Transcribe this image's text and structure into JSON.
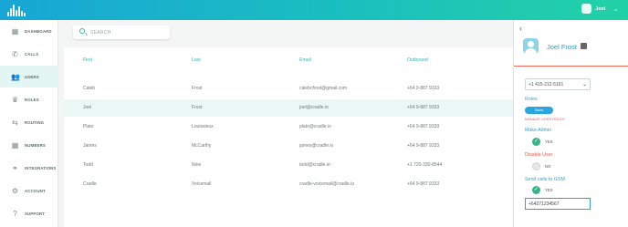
{
  "topbar": {
    "user_name": "Joel"
  },
  "sidebar": {
    "items": [
      {
        "label": "DASHBOARD",
        "icon": "dashboard-icon",
        "glyph": "▦"
      },
      {
        "label": "CALLS",
        "icon": "phone-icon",
        "glyph": "✆"
      },
      {
        "label": "USERS",
        "icon": "users-icon",
        "glyph": "👥",
        "active": true
      },
      {
        "label": "ROLES",
        "icon": "roles-icon",
        "glyph": "♛"
      },
      {
        "label": "ROUTING",
        "icon": "routing-icon",
        "glyph": "⇆"
      },
      {
        "label": "NUMBERS",
        "icon": "numbers-icon",
        "glyph": "▦"
      },
      {
        "label": "INTEGRATIONS",
        "icon": "integrations-icon",
        "glyph": "⚭"
      },
      {
        "label": "ACCOUNT",
        "icon": "account-icon",
        "glyph": "⚙"
      },
      {
        "label": "SUPPORT",
        "icon": "support-icon",
        "glyph": "?"
      }
    ]
  },
  "search": {
    "placeholder": "SEARCH"
  },
  "table": {
    "headers": {
      "first": "First",
      "last": "Last",
      "email": "Email",
      "outbound": "Outbound"
    },
    "rows": [
      {
        "first": "Caleb",
        "last": "Frost",
        "email": "calebcfrost@gmail.com",
        "outbound": "+64 9-887 9333"
      },
      {
        "first": "Joel",
        "last": "Frost",
        "email": "joel@cradle.io",
        "outbound": "+64 9-887 9333",
        "selected": true
      },
      {
        "first": "Plato",
        "last": "Louissieux",
        "email": "plato@cradle.io",
        "outbound": "+64 9-887 9333"
      },
      {
        "first": "James",
        "last": "McCarthy",
        "email": "james@cradle.io",
        "outbound": "+64 9-887 9333"
      },
      {
        "first": "Todd",
        "last": "Nine",
        "email": "todd@cradle.io",
        "outbound": "+1 720-330-8544"
      },
      {
        "first": "Cradle",
        "last": "Voicemail",
        "email": "cradle-voicemail@cradle.io",
        "outbound": "+64 9-887 9333"
      }
    ]
  },
  "panel": {
    "name": "Joel Frost",
    "phone_value": "+1 415-212-5161",
    "roles_label": "Roles",
    "role_pill": "Sales",
    "manage_roles": "MANAGE USER ROLES",
    "make_admin_label": "Make Admin",
    "make_admin_value": "YES",
    "disable_user_label": "Disable User",
    "disable_user_value": "NO",
    "send_calls_label": "Send calls to GSM",
    "send_calls_value": "YES",
    "gsm_number": "+64271234567"
  }
}
